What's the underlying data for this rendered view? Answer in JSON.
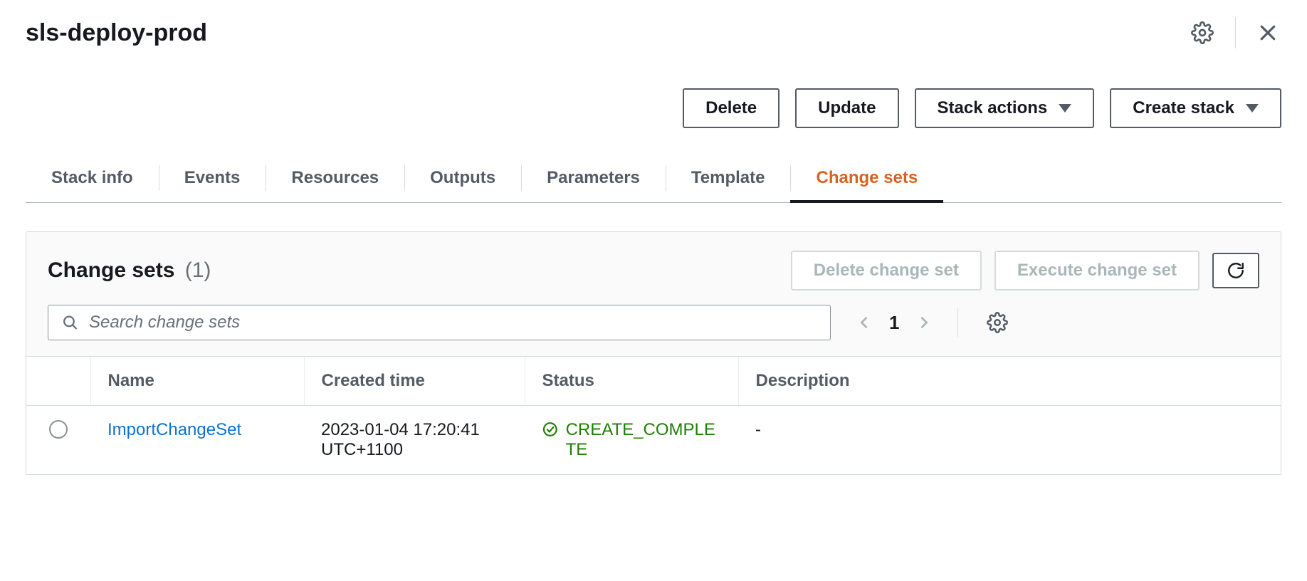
{
  "stack_title": "sls-deploy-prod",
  "actions": {
    "delete": "Delete",
    "update": "Update",
    "stack_actions": "Stack actions",
    "create_stack": "Create stack"
  },
  "tabs": [
    {
      "label": "Stack info",
      "active": false
    },
    {
      "label": "Events",
      "active": false
    },
    {
      "label": "Resources",
      "active": false
    },
    {
      "label": "Outputs",
      "active": false
    },
    {
      "label": "Parameters",
      "active": false
    },
    {
      "label": "Template",
      "active": false
    },
    {
      "label": "Change sets",
      "active": true
    }
  ],
  "panel": {
    "title": "Change sets",
    "count": "(1)",
    "delete_cs": "Delete change set",
    "execute_cs": "Execute change set",
    "search_placeholder": "Search change sets",
    "page": "1"
  },
  "table": {
    "headers": {
      "name": "Name",
      "created": "Created time",
      "status": "Status",
      "description": "Description"
    },
    "rows": [
      {
        "name": "ImportChangeSet",
        "created": "2023-01-04 17:20:41 UTC+1100",
        "status": "CREATE_COMPLETE",
        "description": "-"
      }
    ]
  }
}
